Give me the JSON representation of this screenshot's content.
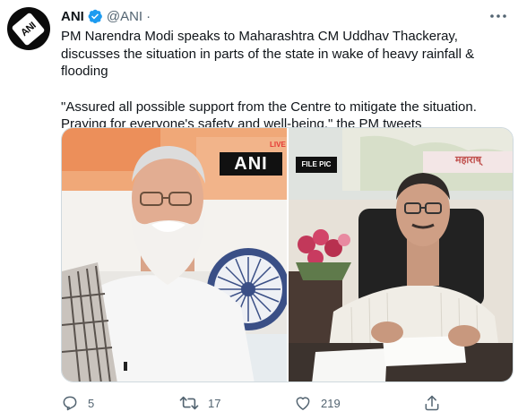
{
  "tweet": {
    "author": {
      "display_name": "ANI",
      "handle": "@ANI",
      "separator": "·",
      "avatar_text": "ANI",
      "verified": true
    },
    "text": {
      "paragraph1": "PM Narendra Modi speaks to Maharashtra CM Uddhav Thackeray, discusses the situation in parts of the state in wake of heavy rainfall & flooding",
      "paragraph2": "\"Assured all possible support from the Centre to mitigate the situation. Praying for everyone's safety and well-being,\" the PM tweets"
    },
    "media": {
      "left_overlay": "ANI",
      "left_live": "LIVE",
      "right_overlay": "FILE PIC",
      "map_label": "महाराष्"
    },
    "actions": {
      "reply_icon": "reply-icon",
      "reply_count": "5",
      "retweet_icon": "retweet-icon",
      "retweet_count": "17",
      "like_icon": "heart-icon",
      "like_count": "219",
      "share_icon": "share-icon"
    }
  },
  "colors": {
    "text": "#0f1419",
    "secondary": "#536471",
    "verified": "#1d9bf0",
    "border": "#cfd9de"
  }
}
